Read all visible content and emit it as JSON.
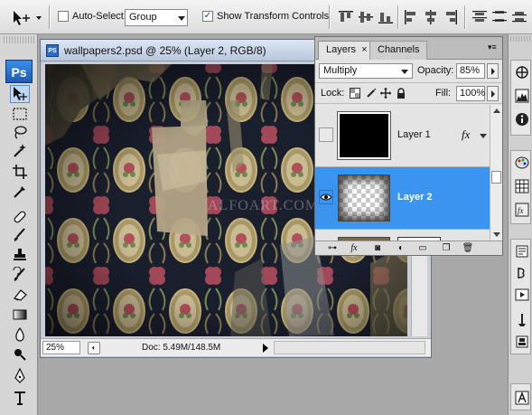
{
  "options_bar": {
    "auto_select_label": "Auto-Select:",
    "auto_select_checked": false,
    "auto_select_target": "Group",
    "show_transform_label": "Show Transform Controls",
    "show_transform_checked": true
  },
  "toolbox": {
    "logo": "Ps"
  },
  "document": {
    "title": "wallpapers2.psd @ 25% (Layer 2, RGB/8)",
    "icon_text": "PS",
    "zoom": "25%",
    "doc_info": "Doc: 5.49M/148.5M",
    "watermark": "ALFOART.COM"
  },
  "layers_panel": {
    "tabs": [
      {
        "label": "Layers",
        "active": true
      },
      {
        "label": "Channels",
        "active": false
      }
    ],
    "tab_close": "×",
    "blend_mode": "Multiply",
    "opacity_label": "Opacity:",
    "opacity_value": "85%",
    "lock_label": "Lock:",
    "fill_label": "Fill:",
    "fill_value": "100%",
    "layers": [
      {
        "name": "Layer 1",
        "visible": false,
        "selected": false,
        "has_fx": true,
        "fx_label": "fx"
      },
      {
        "name": "Layer 2",
        "visible": true,
        "selected": true,
        "has_fx": false
      }
    ],
    "footer_fx": "fx"
  },
  "colors": {
    "selection_blue": "#3b94f0",
    "ps_blue": "#2e6dc4"
  }
}
